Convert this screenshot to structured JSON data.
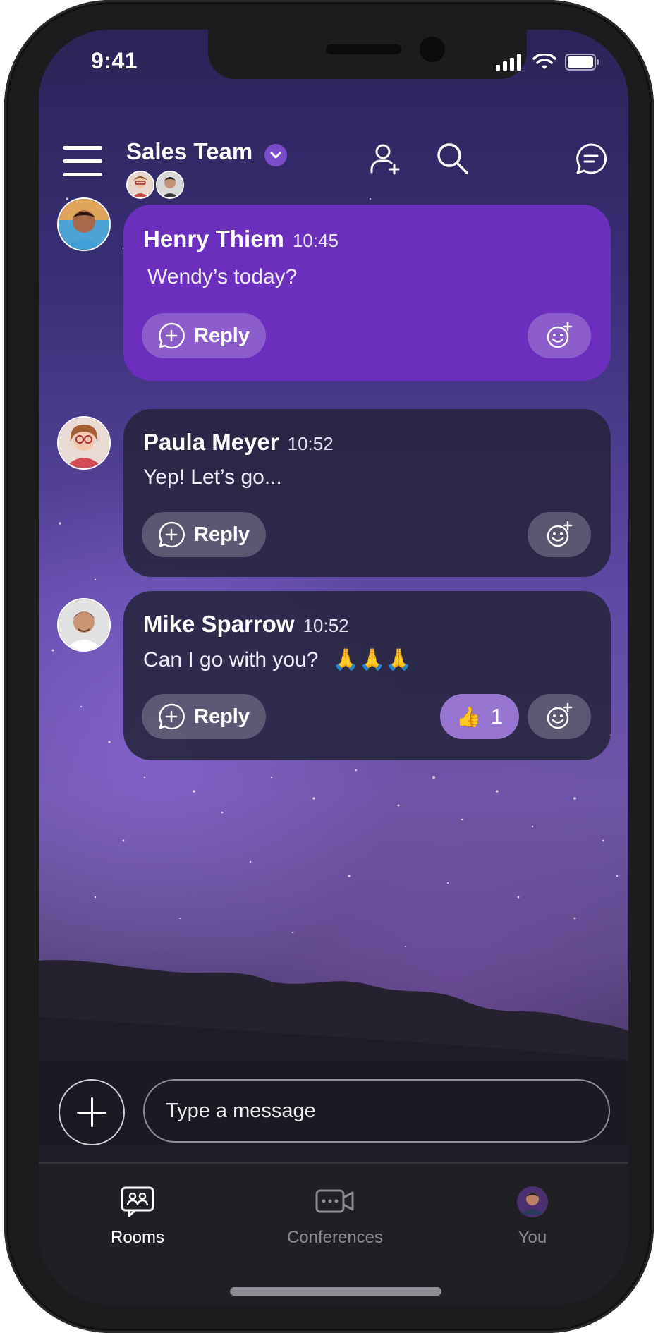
{
  "status_bar": {
    "time": "9:41"
  },
  "header": {
    "team_name": "Sales Team"
  },
  "messages": [
    {
      "sender": "Henry Thiem",
      "time": "10:45",
      "text": "Wendy’s today?",
      "reply_label": "Reply"
    },
    {
      "sender": "Paula Meyer",
      "time": "10:52",
      "text": "Yep! Let’s go...",
      "reply_label": "Reply"
    },
    {
      "sender": "Mike Sparrow",
      "time": "10:52",
      "text": "Can I go with you?",
      "emoji": "🙏🙏🙏",
      "reply_label": "Reply",
      "reaction": {
        "emoji": "👍",
        "count": "1"
      }
    }
  ],
  "composer": {
    "placeholder": "Type a message"
  },
  "tabs": [
    {
      "label": "Rooms"
    },
    {
      "label": "Conferences"
    },
    {
      "label": "You"
    }
  ],
  "colors": {
    "accent": "#6a30bd",
    "reaction": "#9776d2",
    "tabbar": "#1f1f24"
  }
}
